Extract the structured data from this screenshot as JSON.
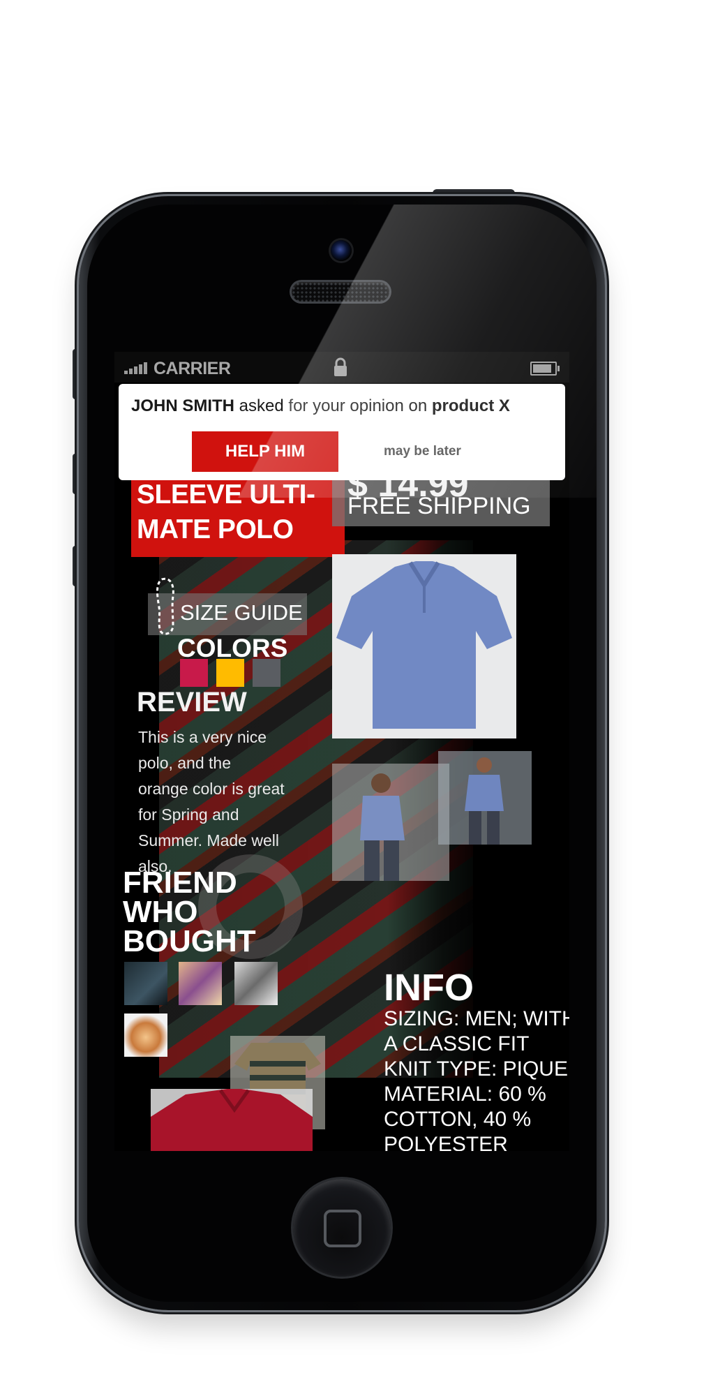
{
  "status_bar": {
    "carrier": "CARRIER",
    "icons": [
      "signal-icon",
      "lock-icon",
      "battery-icon"
    ]
  },
  "notification": {
    "sender": "JOHN SMITH",
    "message": " asked for your opinion on ",
    "product": "product X",
    "primary_action": "HELP HIM",
    "secondary_action": "may be later"
  },
  "product": {
    "title": "SLEEVE ULTI-MATE POLO",
    "shipping": "FREE SHIPPING",
    "size_guide": "SIZE GUIDE",
    "colors_label": "COLORS",
    "colors": [
      "#c81a4a",
      "#ffbb00",
      "#5a5d62"
    ]
  },
  "review": {
    "heading": "REVIEW",
    "text": "This is a very nice polo, and the orange color is great for Spring and Summer. Made well also."
  },
  "friends": {
    "heading": "FRIEND WHO BOUGHT",
    "avatars": [
      "friend-avatar-1",
      "friend-avatar-2",
      "friend-avatar-3",
      "friend-avatar-4"
    ]
  },
  "info": {
    "heading": "INFO",
    "lines": [
      "SIZING: MEN; WITH",
      "A CLASSIC FIT",
      "KNIT TYPE: PIQUE",
      "MATERIAL: 60 %",
      "COTTON, 40 %",
      "POLYESTER"
    ]
  },
  "colors": {
    "accent": "#d0120e",
    "notification_bg": "#ffffff",
    "screen_bg": "#000000"
  }
}
